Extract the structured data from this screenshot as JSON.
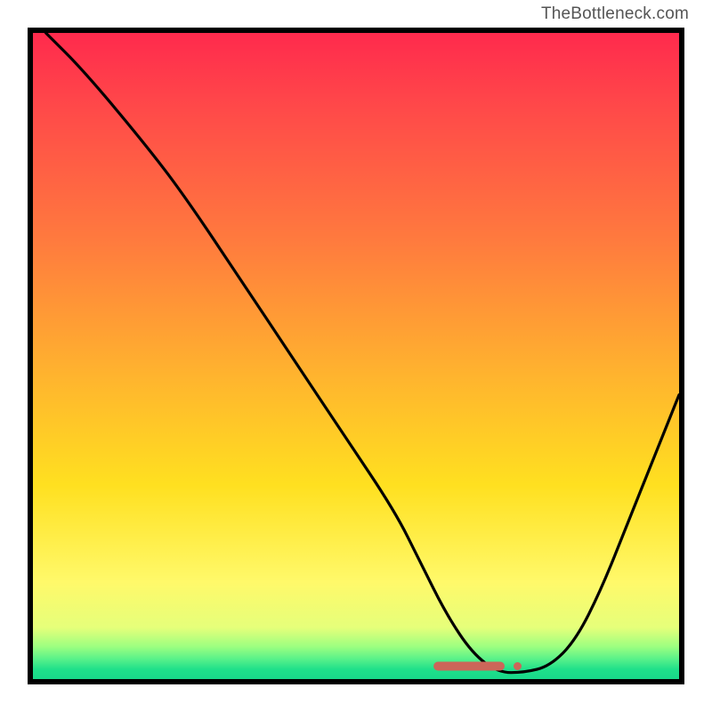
{
  "watermark": "TheBottleneck.com",
  "chart_data": {
    "type": "line",
    "title": "",
    "xlabel": "",
    "ylabel": "",
    "xlim": [
      0,
      100
    ],
    "ylim": [
      0,
      100
    ],
    "grid": false,
    "legend": false,
    "gradient_stops": [
      {
        "pos": 0.0,
        "color": "#ff2a4d"
      },
      {
        "pos": 0.12,
        "color": "#ff4a49"
      },
      {
        "pos": 0.32,
        "color": "#ff7a3e"
      },
      {
        "pos": 0.52,
        "color": "#ffb12f"
      },
      {
        "pos": 0.7,
        "color": "#ffe020"
      },
      {
        "pos": 0.85,
        "color": "#fff96a"
      },
      {
        "pos": 0.92,
        "color": "#e6ff7a"
      },
      {
        "pos": 0.95,
        "color": "#9cff80"
      },
      {
        "pos": 0.97,
        "color": "#55f08a"
      },
      {
        "pos": 0.985,
        "color": "#1fe08a"
      },
      {
        "pos": 1.0,
        "color": "#18d88a"
      }
    ],
    "marker": {
      "shape": "rounded-bar",
      "color": "#cc6659",
      "x_start": 62,
      "x_end": 73,
      "y": 2,
      "dot_x": 75,
      "dot_y": 2
    },
    "series": [
      {
        "name": "bottleneck-curve",
        "color": "#000000",
        "x": [
          2,
          8,
          18,
          24,
          32,
          40,
          48,
          56,
          60,
          64,
          68,
          72,
          76,
          80,
          84,
          88,
          92,
          96,
          100
        ],
        "y": [
          100,
          94,
          82,
          74,
          62,
          50,
          38,
          26,
          18,
          10,
          4,
          1,
          1,
          2,
          6,
          14,
          24,
          34,
          44
        ]
      }
    ]
  }
}
